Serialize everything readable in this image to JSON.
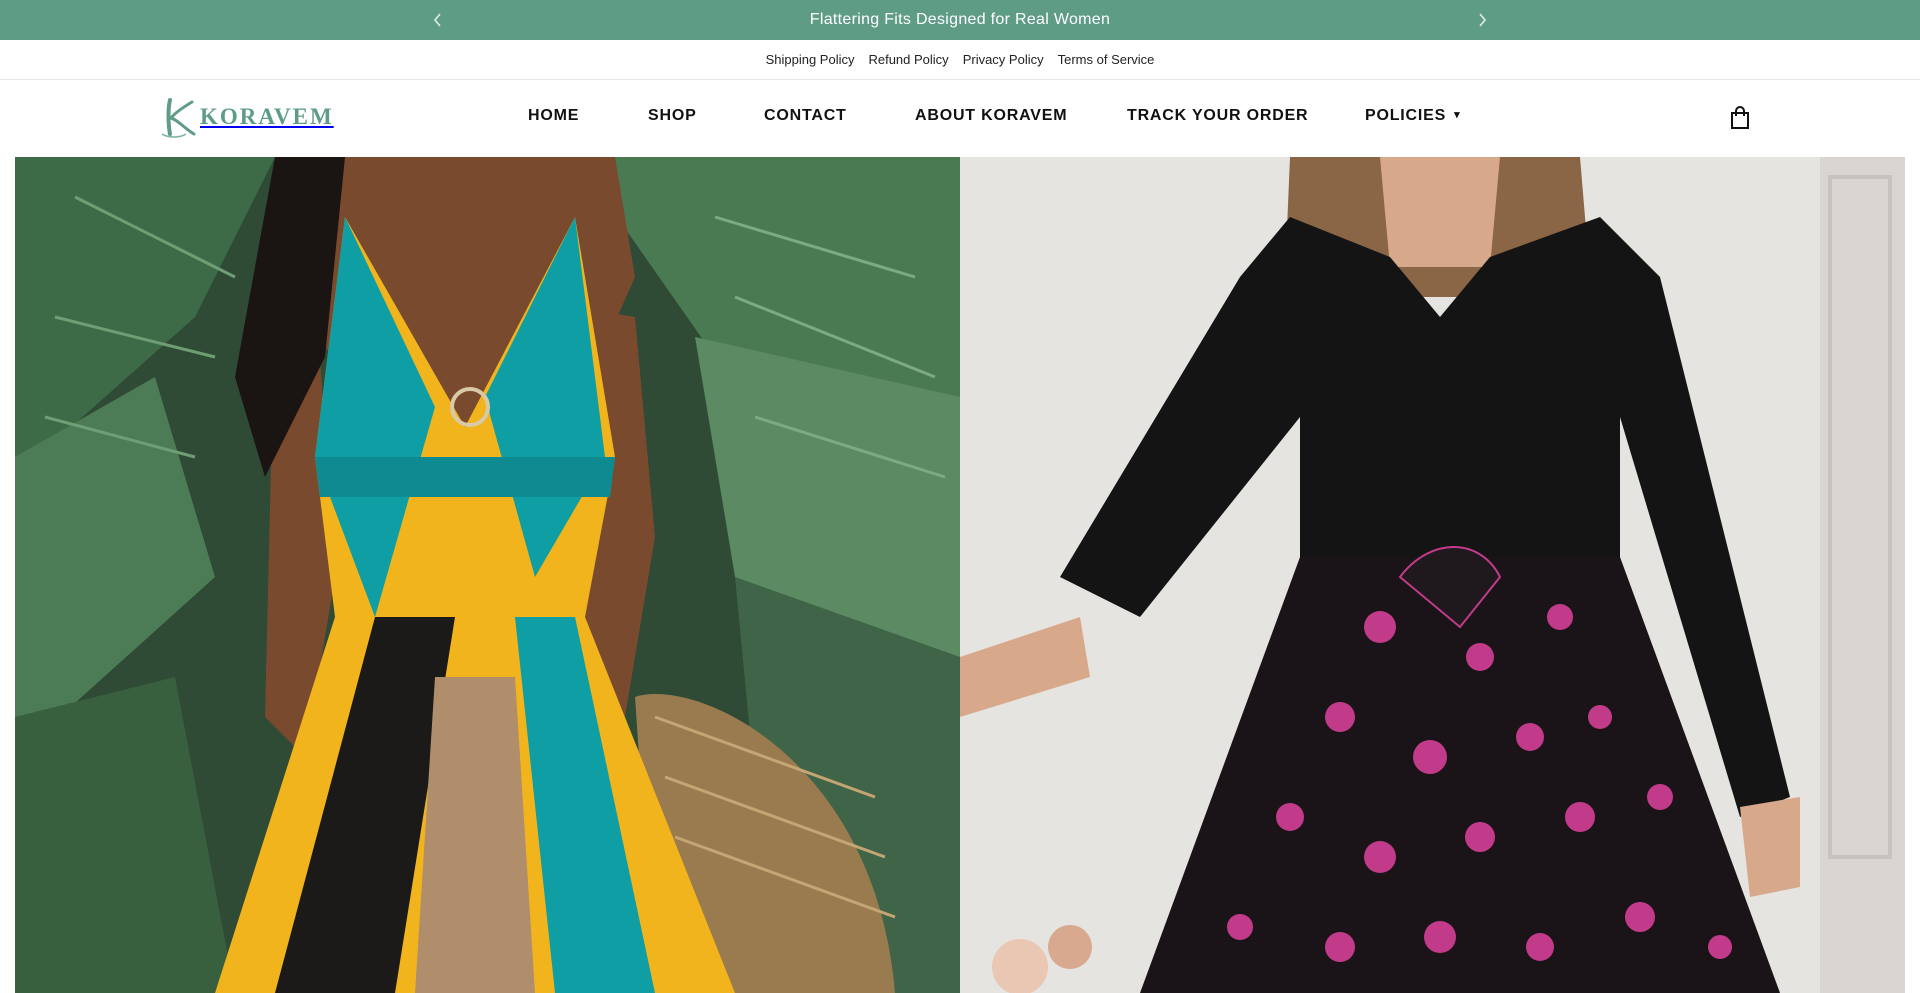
{
  "announcement": {
    "message": "Flattering Fits Designed for Real Women",
    "prev_icon": "chevron-left-icon",
    "next_icon": "chevron-right-icon",
    "bg_color": "#5f9c86"
  },
  "policy_links": [
    "Shipping Policy",
    "Refund Policy",
    "Privacy Policy",
    "Terms of Service"
  ],
  "header": {
    "logo_text": "KORAVEM",
    "logo_initial": "K",
    "cart_icon": "shopping-bag-icon"
  },
  "nav": {
    "items": [
      "HOME",
      "SHOP",
      "CONTACT",
      "ABOUT KORAVEM",
      "TRACK YOUR ORDER",
      "POLICIES"
    ],
    "dropdown_icon": "chevron-down-icon"
  },
  "hero": {
    "images": [
      "woman-in-colorful-printed-maxi-dress-image",
      "woman-in-black-floral-midi-dress-image"
    ]
  }
}
